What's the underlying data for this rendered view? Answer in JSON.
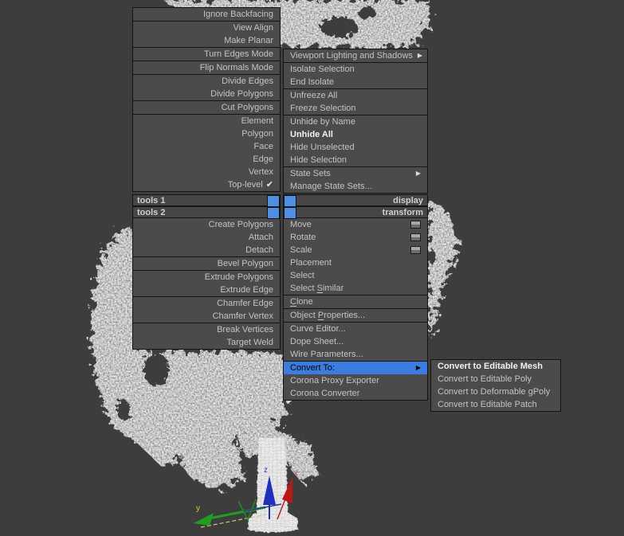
{
  "viewport": {
    "axis_labels": {
      "x": "x",
      "y": "y",
      "z": "z"
    }
  },
  "colors": {
    "background": "#3d3d3d",
    "menu_bg": "#4b4b4b",
    "caption_bg": "#464646",
    "highlight": "#3b7cdf",
    "quad_center": "#4f8fe3",
    "axis_x": "#c22020",
    "axis_y": "#22a022",
    "axis_z": "#2233cc"
  },
  "caption_bars": [
    {
      "id": "tools1-caption",
      "label": "tools 1",
      "side": "left",
      "row": 0
    },
    {
      "id": "display-caption",
      "label": "display",
      "side": "right",
      "row": 0
    },
    {
      "id": "tools2-caption",
      "label": "tools 2",
      "side": "left",
      "row": 1
    },
    {
      "id": "transform-caption",
      "label": "transform",
      "side": "right",
      "row": 1
    }
  ],
  "menus": [
    {
      "id": "quad-tools1",
      "align": "right",
      "groups": [
        [
          {
            "label": "Ignore Backfacing"
          }
        ],
        [
          {
            "label": "View Align"
          },
          {
            "label": "Make Planar"
          }
        ],
        [
          {
            "label": "Turn Edges Mode"
          }
        ],
        [
          {
            "label": "Flip Normals Mode"
          }
        ],
        [
          {
            "label": "Divide Edges"
          },
          {
            "label": "Divide Polygons"
          }
        ],
        [
          {
            "label": "Cut Polygons"
          }
        ],
        [
          {
            "label": "Element"
          },
          {
            "label": "Polygon"
          },
          {
            "label": "Face"
          },
          {
            "label": "Edge"
          },
          {
            "label": "Vertex"
          },
          {
            "label": "Top-level",
            "check": true
          }
        ]
      ]
    },
    {
      "id": "quad-display",
      "align": "left",
      "groups": [
        [
          {
            "label": "Viewport Lighting and Shadows",
            "arrow": true
          }
        ],
        [
          {
            "label": "Isolate Selection"
          },
          {
            "label": "End Isolate"
          }
        ],
        [
          {
            "label": "Unfreeze All"
          },
          {
            "label": "Freeze Selection"
          }
        ],
        [
          {
            "label": "Unhide by Name"
          },
          {
            "label": "Unhide All",
            "bold": true
          },
          {
            "label": "Hide Unselected"
          },
          {
            "label": "Hide Selection"
          }
        ],
        [
          {
            "label": "State Sets",
            "arrow": true
          },
          {
            "label": "Manage State Sets..."
          }
        ]
      ]
    },
    {
      "id": "quad-tools2",
      "align": "right",
      "groups": [
        [
          {
            "label": "Create Polygons"
          },
          {
            "label": "Attach"
          },
          {
            "label": "Detach"
          }
        ],
        [
          {
            "label": "Bevel Polygon"
          }
        ],
        [
          {
            "label": "Extrude Polygons"
          },
          {
            "label": "Extrude Edge"
          }
        ],
        [
          {
            "label": "Chamfer Edge"
          },
          {
            "label": "Chamfer Vertex"
          }
        ],
        [
          {
            "label": "Break Vertices"
          },
          {
            "label": "Target Weld"
          }
        ]
      ]
    },
    {
      "id": "quad-transform",
      "align": "left",
      "groups": [
        [
          {
            "label": "Move",
            "box_icon": true
          },
          {
            "label": "Rotate",
            "box_icon": true
          },
          {
            "label": "Scale",
            "box_icon": true
          },
          {
            "label": "Placement"
          },
          {
            "label": "Select"
          },
          {
            "label": "Select Similar",
            "accel": 7
          }
        ],
        [
          {
            "label": "Clone",
            "accel": 0
          }
        ],
        [
          {
            "label": "Object Properties...",
            "accel": 7
          }
        ],
        [
          {
            "label": "Curve Editor..."
          },
          {
            "label": "Dope Sheet..."
          },
          {
            "label": "Wire Parameters..."
          }
        ],
        [
          {
            "label": "Convert To:",
            "highlight": true,
            "arrow": true
          },
          {
            "label": "Corona Proxy Exporter"
          },
          {
            "label": "Corona Converter"
          }
        ]
      ]
    },
    {
      "id": "submenu-convert-to",
      "align": "left",
      "groups": [
        [
          {
            "label": "Convert to Editable Mesh",
            "bold": true
          },
          {
            "label": "Convert to Editable Poly"
          },
          {
            "label": "Convert to Deformable gPoly"
          },
          {
            "label": "Convert to Editable Patch"
          }
        ]
      ]
    }
  ]
}
